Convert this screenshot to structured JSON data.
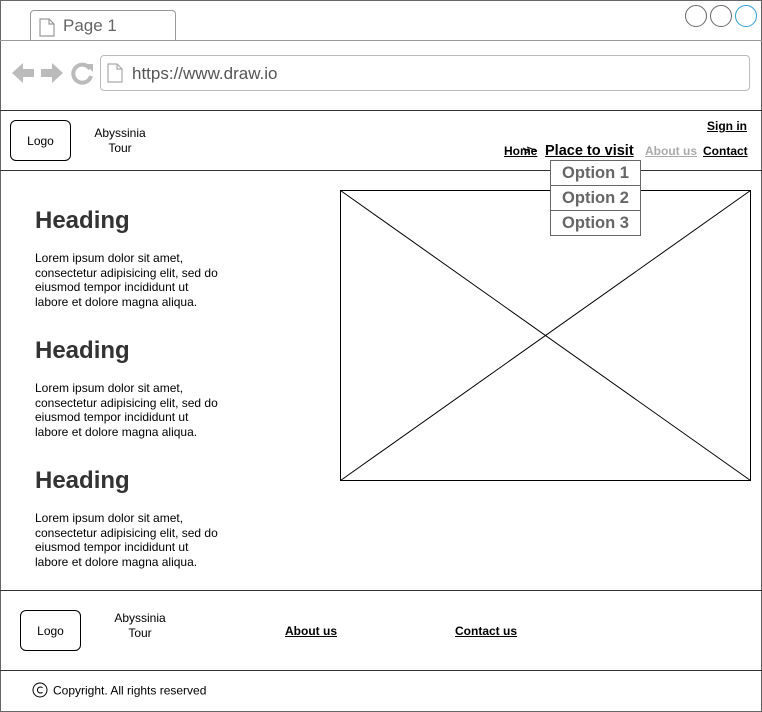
{
  "browser": {
    "tab_label": "Page 1",
    "url": "https://www.draw.io",
    "window_button_colors": [
      "#666666",
      "#666666",
      "#2a9fd6"
    ]
  },
  "header": {
    "logo_label": "Logo",
    "site_name": "Abyssinia\nTour",
    "sign_in": "Sign in",
    "nav": {
      "home": "Home",
      "place_to_visit": "Place to visit",
      "about_us": "About us",
      "contact": "Contact"
    },
    "dropdown_options": [
      "Option 1",
      "Option 2",
      "Option 3"
    ]
  },
  "sections": [
    {
      "heading": "Heading",
      "text": "Lorem ipsum dolor sit amet, consectetur adipisicing elit, sed do eiusmod tempor incididunt ut labore et dolore magna aliqua."
    },
    {
      "heading": "Heading",
      "text": "Lorem ipsum dolor sit amet, consectetur adipisicing elit, sed do eiusmod tempor incididunt ut labore et dolore magna aliqua."
    },
    {
      "heading": "Heading",
      "text": "Lorem ipsum dolor sit amet, consectetur adipisicing elit, sed do eiusmod tempor incididunt ut labore et dolore magna aliqua."
    }
  ],
  "footer": {
    "logo_label": "Logo",
    "site_name": "Abyssinia\nTour",
    "about_us": "About us",
    "contact_us": "Contact us",
    "copyright": "Copyright. All rights reserved"
  }
}
